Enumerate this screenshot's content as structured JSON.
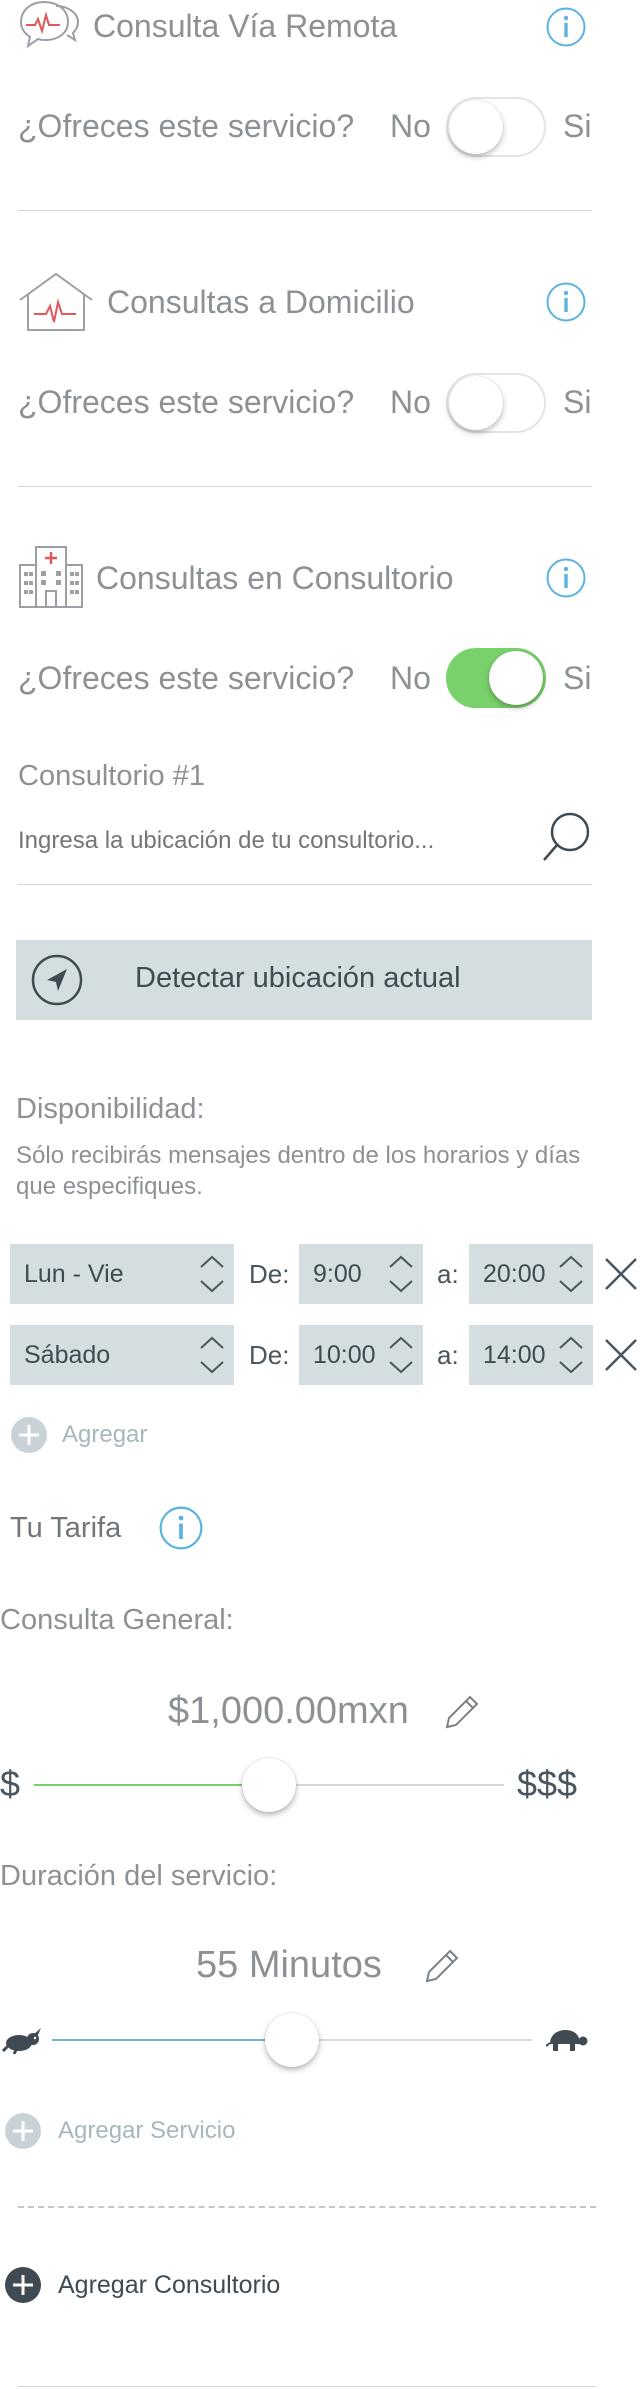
{
  "services": {
    "remote": {
      "title": "Consulta Vía Remota",
      "question": "¿Ofreces este servicio?",
      "no": "No",
      "yes": "Si",
      "enabled": false
    },
    "home": {
      "title": "Consultas a Domicilio",
      "question": "¿Ofreces este servicio?",
      "no": "No",
      "yes": "Si",
      "enabled": false
    },
    "office": {
      "title": "Consultas en Consultorio",
      "question": "¿Ofreces este servicio?",
      "no": "No",
      "yes": "Si",
      "enabled": true
    }
  },
  "office1": {
    "title": "Consultorio #1",
    "search_placeholder": "Ingresa la ubicación de tu consultorio...",
    "detect_label": "Detectar ubicación actual"
  },
  "availability": {
    "title": "Disponibilidad:",
    "note": "Sólo recibirás mensajes dentro de los horarios y días que especifiques.",
    "rows": [
      {
        "days": "Lun - Vie",
        "from_label": "De:",
        "from": "9:00",
        "to_label": "a:",
        "to": "20:00"
      },
      {
        "days": "Sábado",
        "from_label": "De:",
        "from": "10:00",
        "to_label": "a:",
        "to": "14:00"
      }
    ],
    "add_label": "Agregar"
  },
  "tariff": {
    "title": "Tu Tarifa",
    "general_label": "Consulta General:",
    "price": "$1,000.00mxn",
    "slider_min": "$",
    "slider_max": "$$$",
    "price_level": 0.5,
    "duration_label": "Duración del servicio:",
    "duration": "55 Minutos",
    "duration_level": 0.5,
    "add_service": "Agregar Servicio"
  },
  "add_office": "Agregar Consultorio",
  "colors": {
    "accent_green": "#79d16b",
    "info_blue": "#5ab4df",
    "duration_blue": "#6cb8d6",
    "button_bg": "#d4dde0"
  }
}
